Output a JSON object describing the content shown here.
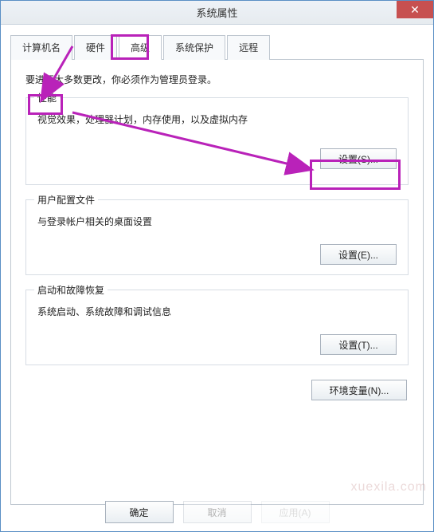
{
  "window": {
    "title": "系统属性"
  },
  "tabs": {
    "items": [
      {
        "label": "计算机名"
      },
      {
        "label": "硬件"
      },
      {
        "label": "高级"
      },
      {
        "label": "系统保护"
      },
      {
        "label": "远程"
      }
    ],
    "active_index": 2
  },
  "advanced": {
    "intro": "要进行大多数更改，你必须作为管理员登录。",
    "performance": {
      "legend": "性能",
      "desc": "视觉效果，处理器计划，内存使用，以及虚拟内存",
      "button": "设置(S)..."
    },
    "user_profiles": {
      "legend": "用户配置文件",
      "desc": "与登录帐户相关的桌面设置",
      "button": "设置(E)..."
    },
    "startup": {
      "legend": "启动和故障恢复",
      "desc": "系统启动、系统故障和调试信息",
      "button": "设置(T)..."
    },
    "env_button": "环境变量(N)..."
  },
  "dialog": {
    "ok": "确定",
    "cancel": "取消",
    "apply": "应用(A)"
  },
  "watermark": "xuexila.com"
}
